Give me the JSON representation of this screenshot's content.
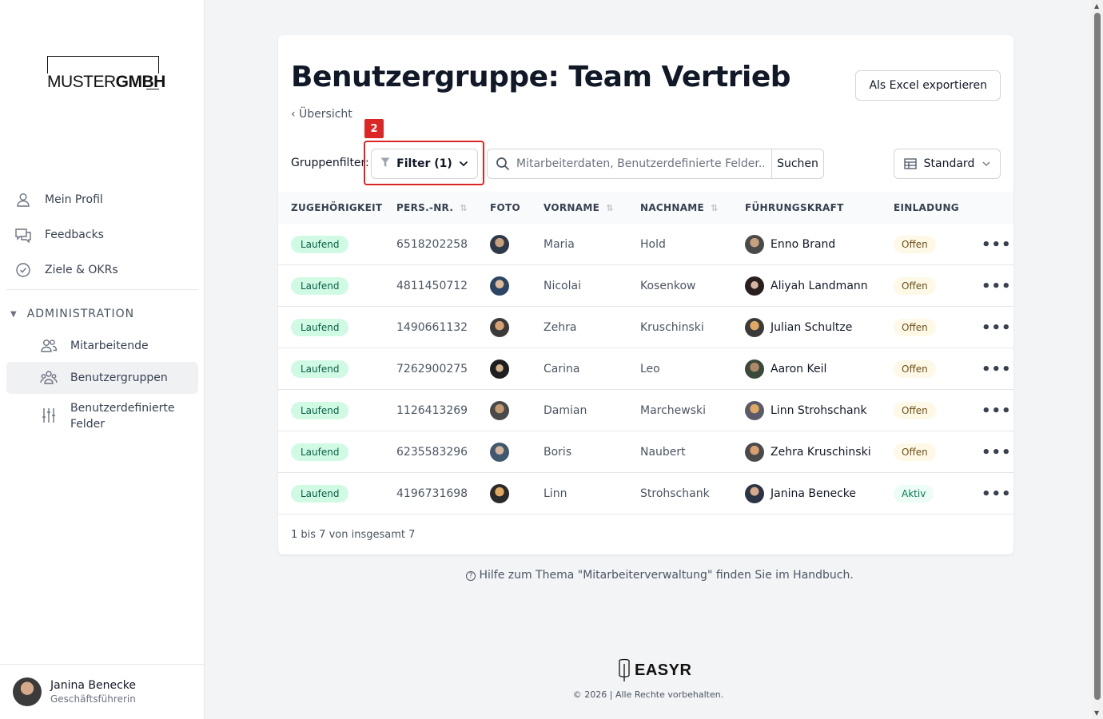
{
  "brand": {
    "logo_light": "MUSTER",
    "logo_bold": "GMBH"
  },
  "sidebar": {
    "items": [
      {
        "label": "Mein Profil",
        "icon": "user-icon"
      },
      {
        "label": "Feedbacks",
        "icon": "chat-icon"
      },
      {
        "label": "Ziele & OKRs",
        "icon": "check-circle-icon"
      }
    ],
    "admin_label": "ADMINISTRATION",
    "sub_items": [
      {
        "label": "Mitarbeitende",
        "icon": "users-icon"
      },
      {
        "label": "Benutzergruppen",
        "icon": "user-group-icon",
        "active": true
      },
      {
        "label": "Benutzerdefinierte Felder",
        "icon": "sliders-icon"
      }
    ],
    "user": {
      "name": "Janina Benecke",
      "role": "Geschäftsführerin"
    }
  },
  "page": {
    "title": "Benutzergruppe: Team Vertrieb",
    "export_label": "Als Excel exportieren",
    "back_label": "‹ Übersicht",
    "group_filter_label": "Gruppenfilter:",
    "filter_label": "Filter (1)",
    "annotation_number": "2",
    "search_placeholder": "Mitarbeiterdaten, Benutzerdefinierte Felder...",
    "search_button": "Suchen",
    "view_label": "Standard"
  },
  "table": {
    "headers": [
      "ZUGEHÖRIGKEIT",
      "PERS.-NR.",
      "FOTO",
      "VORNAME",
      "NACHNAME",
      "FÜHRUNGSKRAFT",
      "EINLADUNG"
    ],
    "rows": [
      {
        "status": "Laufend",
        "nr": "6518202258",
        "first": "Maria",
        "last": "Hold",
        "manager": "Enno Brand",
        "invite": "Offen"
      },
      {
        "status": "Laufend",
        "nr": "4811450712",
        "first": "Nicolai",
        "last": "Kosenkow",
        "manager": "Aliyah Landmann",
        "invite": "Offen"
      },
      {
        "status": "Laufend",
        "nr": "1490661132",
        "first": "Zehra",
        "last": "Kruschinski",
        "manager": "Julian Schultze",
        "invite": "Offen"
      },
      {
        "status": "Laufend",
        "nr": "7262900275",
        "first": "Carina",
        "last": "Leo",
        "manager": "Aaron Keil",
        "invite": "Offen"
      },
      {
        "status": "Laufend",
        "nr": "1126413269",
        "first": "Damian",
        "last": "Marchewski",
        "manager": "Linn Strohschank",
        "invite": "Offen"
      },
      {
        "status": "Laufend",
        "nr": "6235583296",
        "first": "Boris",
        "last": "Naubert",
        "manager": "Zehra Kruschinski",
        "invite": "Offen"
      },
      {
        "status": "Laufend",
        "nr": "4196731698",
        "first": "Linn",
        "last": "Strohschank",
        "manager": "Janina Benecke",
        "invite": "Aktiv"
      }
    ],
    "pagination": "1 bis 7 von insgesamt 7"
  },
  "help": {
    "text": "Hilfe zum Thema \"Mitarbeiterverwaltung\" finden Sie im Handbuch."
  },
  "footer": {
    "brand": "EASYR",
    "copyright": "© 2026 | Alle Rechte vorbehalten."
  }
}
